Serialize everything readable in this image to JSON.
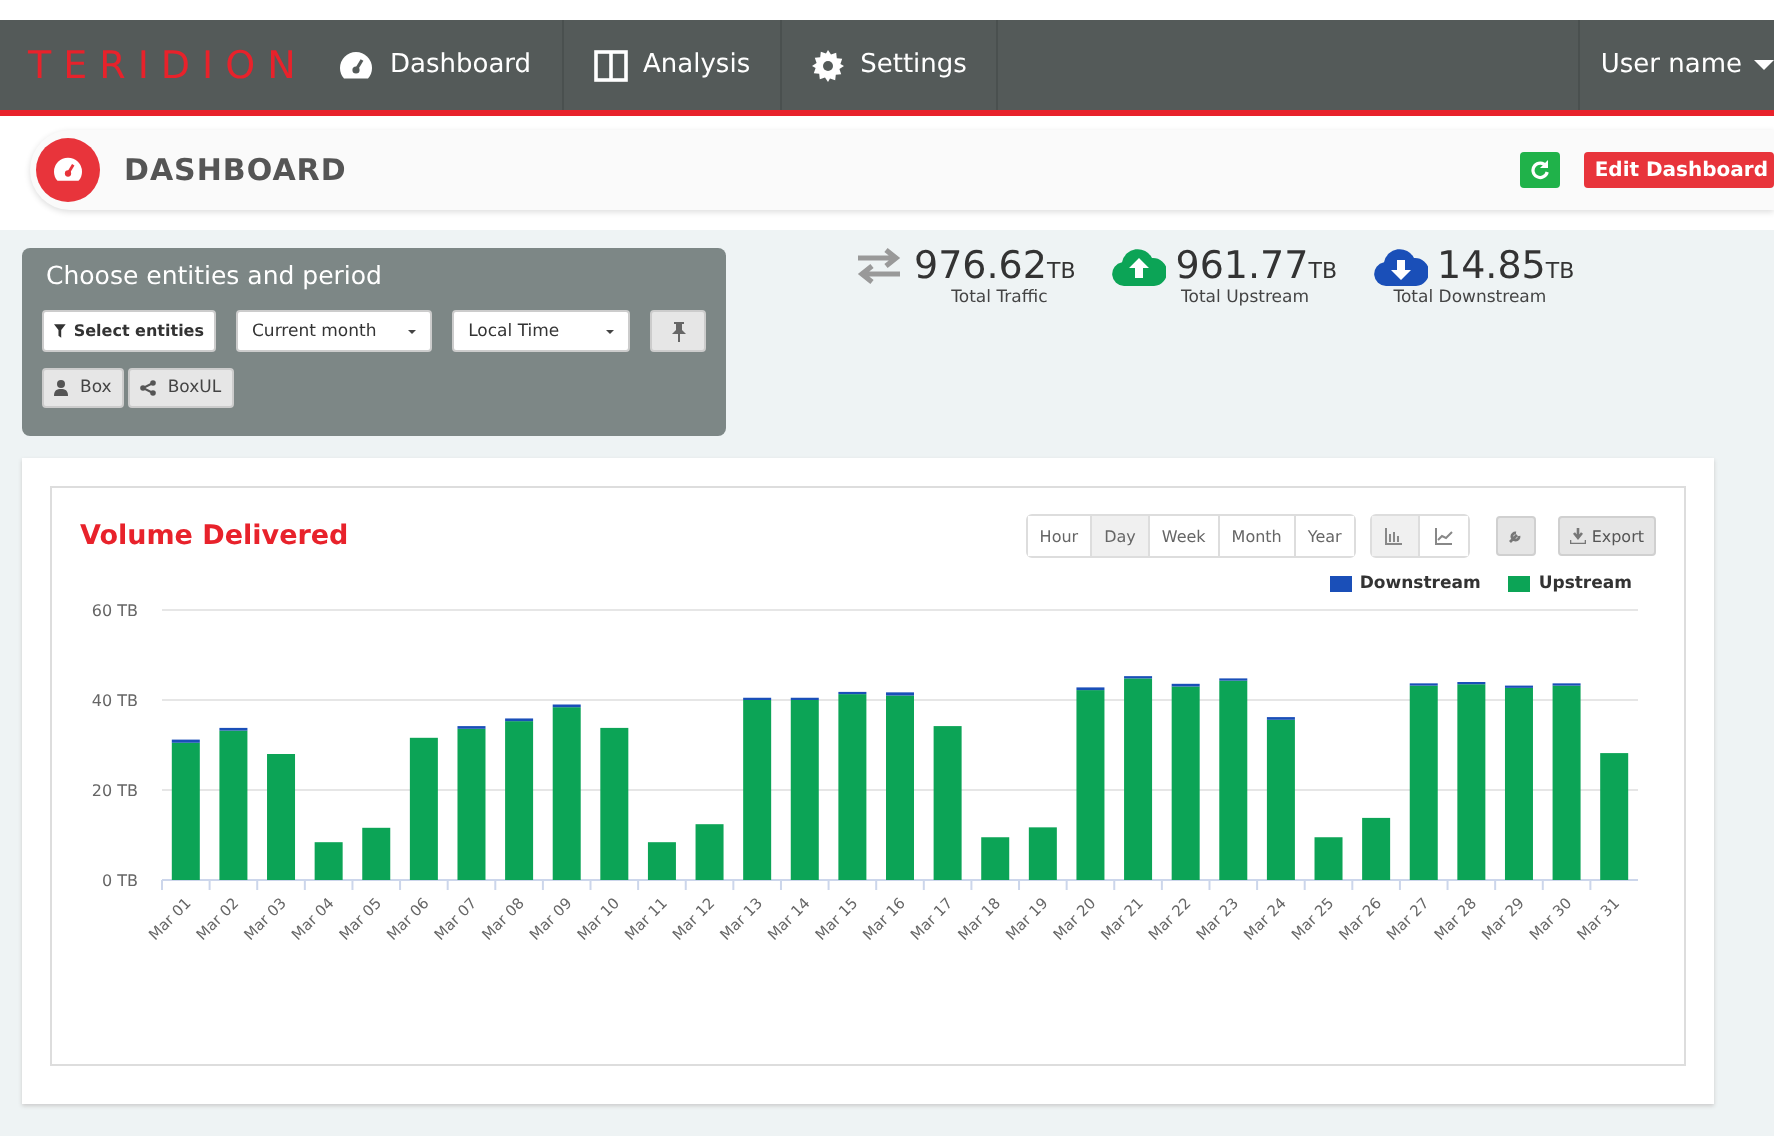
{
  "navbar": {
    "logo": "TERIDION",
    "items": [
      {
        "label": "Dashboard",
        "kind": "dashboard"
      },
      {
        "label": "Analysis",
        "kind": "columns"
      },
      {
        "label": "Settings",
        "kind": "gear"
      }
    ],
    "user": "User name"
  },
  "header": {
    "title": "DASHBOARD",
    "edit_button": "Edit Dashboard"
  },
  "filters": {
    "title": "Choose entities and period",
    "controls": [
      {
        "kind": "filter",
        "label": "Select entities"
      },
      {
        "kind": "dropdown",
        "label": "Current month"
      },
      {
        "kind": "dropdown",
        "label": "Local Time"
      }
    ],
    "chips": [
      {
        "kind": "user",
        "label": "Box"
      },
      {
        "kind": "share",
        "label": "BoxUL"
      }
    ]
  },
  "stats": [
    {
      "kind": "arrows",
      "value": "976.62",
      "unit": "TB",
      "label": "Total Traffic"
    },
    {
      "kind": "up",
      "value": "961.77",
      "unit": "TB",
      "label": "Total Upstream"
    },
    {
      "kind": "down",
      "value": "14.85",
      "unit": "TB",
      "label": "Total Downstream"
    }
  ],
  "chart_card": {
    "title": "Volume Delivered",
    "periods": [
      {
        "label": "Hour",
        "selected": false
      },
      {
        "label": "Day",
        "selected": true
      },
      {
        "label": "Week",
        "selected": false
      },
      {
        "label": "Month",
        "selected": false
      },
      {
        "label": "Year",
        "selected": false
      }
    ],
    "chart_types": [
      {
        "kind": "bar",
        "selected": true
      },
      {
        "kind": "line",
        "selected": false
      }
    ],
    "export": "Export",
    "chart_data": {
      "type": "bar",
      "stacked": true,
      "categories": [
        "Mar 01",
        "Mar 02",
        "Mar 03",
        "Mar 04",
        "Mar 05",
        "Mar 06",
        "Mar 07",
        "Mar 08",
        "Mar 09",
        "Mar 10",
        "Mar 11",
        "Mar 12",
        "Mar 13",
        "Mar 14",
        "Mar 15",
        "Mar 16",
        "Mar 17",
        "Mar 18",
        "Mar 19",
        "Mar 20",
        "Mar 21",
        "Mar 22",
        "Mar 23",
        "Mar 24",
        "Mar 25",
        "Mar 26",
        "Mar 27",
        "Mar 28",
        "Mar 29",
        "Mar 30",
        "Mar 31"
      ],
      "series": [
        {
          "name": "Upstream",
          "color": "#0ca456",
          "values": [
            30.5,
            33.2,
            28,
            8.4,
            11.6,
            31.6,
            33.6,
            35.3,
            38.4,
            33.8,
            8.4,
            12.4,
            40,
            40,
            41.3,
            41,
            34.2,
            9.5,
            11.7,
            42.2,
            44.8,
            43,
            44.3,
            35.6,
            9.5,
            13.8,
            43.2,
            43.5,
            42.7,
            43.2,
            28.2
          ]
        },
        {
          "name": "Downstream",
          "color": "#1a4fb8",
          "values": [
            0.7,
            0.6,
            0,
            0,
            0,
            0,
            0.6,
            0.6,
            0.6,
            0,
            0,
            0,
            0.5,
            0.5,
            0.5,
            0.7,
            0,
            0,
            0,
            0.6,
            0.5,
            0.6,
            0.5,
            0.6,
            0,
            0,
            0.5,
            0.5,
            0.5,
            0.5,
            0
          ]
        }
      ],
      "ylim": [
        0,
        60
      ],
      "yticks": [
        {
          "value": 0,
          "label": "0 TB"
        },
        {
          "value": 20,
          "label": "20 TB"
        },
        {
          "value": 40,
          "label": "40 TB"
        },
        {
          "value": 60,
          "label": "60 TB"
        }
      ]
    }
  }
}
